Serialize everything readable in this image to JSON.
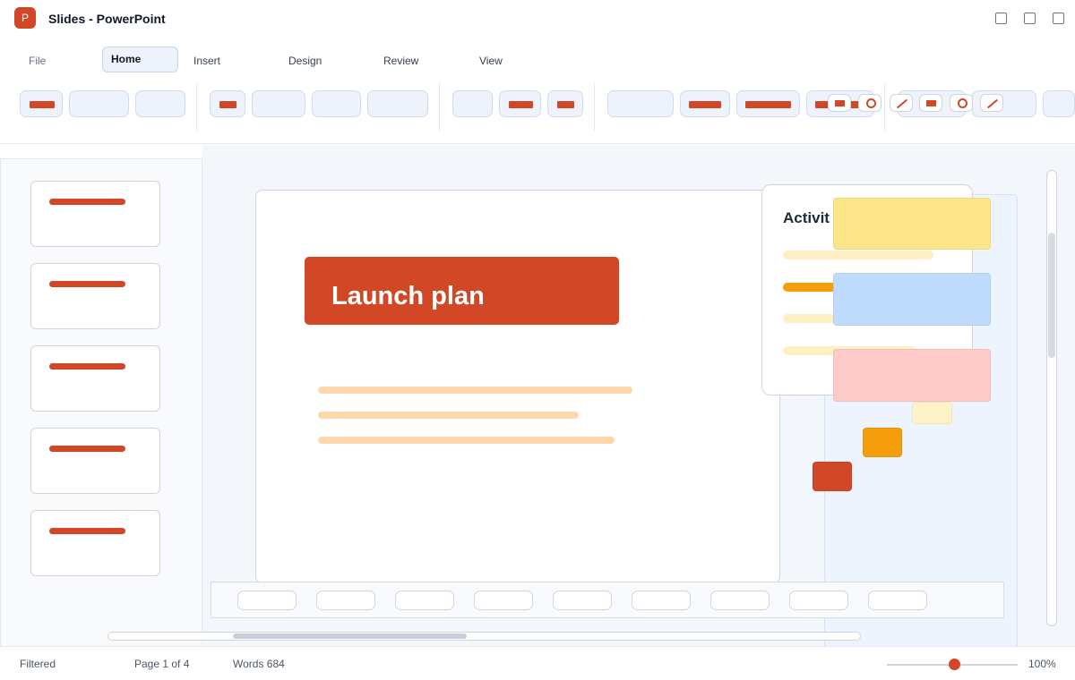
{
  "window": {
    "app_icon_letter": "P",
    "title": "Slides - PowerPoint"
  },
  "menu": {
    "file": "File",
    "home": "Home",
    "insert": "Insert",
    "design": "Design",
    "review": "Review",
    "view": "View"
  },
  "slide": {
    "title": "Launch plan"
  },
  "activity_panel": {
    "title": "Activit"
  },
  "status": {
    "filter": "Filtered",
    "page": "Page 1 of 4",
    "words": "Words 684",
    "zoom": "100%",
    "zoom_level_percent": 52
  },
  "colors": {
    "accent": "#d24726",
    "note_yellow": "#fde68a",
    "note_blue": "#bfdbfe",
    "note_pink": "#fecaca",
    "note_orange": "#f59e0b"
  }
}
